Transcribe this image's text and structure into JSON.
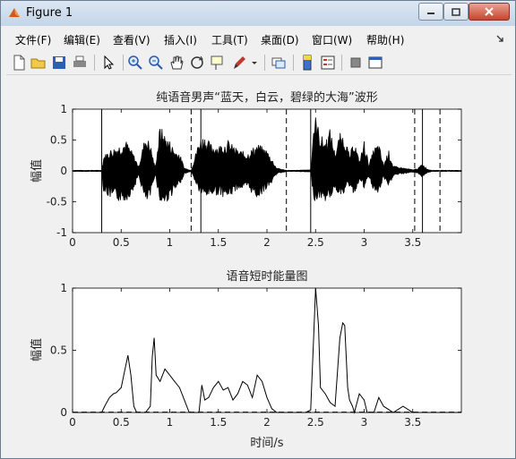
{
  "window": {
    "title": "Figure 1",
    "icons": [
      "matlab-icon",
      "minimize-icon",
      "maximize-icon",
      "close-icon"
    ]
  },
  "menu": [
    "文件(F)",
    "编辑(E)",
    "查看(V)",
    "插入(I)",
    "工具(T)",
    "桌面(D)",
    "窗口(W)",
    "帮助(H)"
  ],
  "toolbar": [
    "new-figure-icon",
    "open-icon",
    "save-icon",
    "print-icon",
    "pointer-icon",
    "zoom-in-icon",
    "zoom-out-icon",
    "pan-icon",
    "rotate-icon",
    "data-cursor-icon",
    "brush-icon",
    "link-icon",
    "colorbar-icon",
    "legend-icon",
    "hide-tools-icon",
    "show-tools-icon"
  ],
  "chart_data": [
    {
      "type": "line",
      "title": "纯语音男声“蓝天，白云，碧绿的大海”波形",
      "xlabel": "",
      "ylabel": "幅值",
      "xlim": [
        0,
        4
      ],
      "ylim": [
        -1,
        1
      ],
      "xticks": [
        "0",
        "0.5",
        "1",
        "1.5",
        "2",
        "2.5",
        "3",
        "3.5"
      ],
      "yticks": [
        "-1",
        "-0.5",
        "0",
        "0.5",
        "1"
      ],
      "envelope": {
        "x": [
          0.0,
          0.3,
          0.32,
          0.38,
          0.45,
          0.55,
          0.62,
          0.68,
          0.75,
          0.8,
          0.85,
          0.9,
          0.95,
          1.0,
          1.05,
          1.1,
          1.15,
          1.22,
          1.3,
          1.35,
          1.42,
          1.5,
          1.6,
          1.7,
          1.8,
          1.9,
          2.0,
          2.05,
          2.1,
          2.2,
          2.3,
          2.45,
          2.48,
          2.5,
          2.55,
          2.6,
          2.65,
          2.7,
          2.75,
          2.8,
          2.85,
          2.9,
          2.95,
          3.0,
          3.05,
          3.1,
          3.15,
          3.2,
          3.25,
          3.3,
          3.4,
          3.5,
          3.55,
          3.6,
          3.65,
          3.7,
          3.8,
          4.0
        ],
        "pos": [
          0.01,
          0.01,
          0.25,
          0.35,
          0.4,
          0.5,
          0.3,
          0.08,
          0.6,
          0.45,
          0.05,
          0.75,
          0.6,
          0.5,
          0.35,
          0.3,
          0.05,
          0.01,
          0.5,
          0.6,
          0.45,
          0.42,
          0.5,
          0.35,
          0.3,
          0.45,
          0.35,
          0.2,
          0.05,
          0.01,
          0.01,
          0.02,
          0.8,
          0.9,
          0.6,
          0.5,
          0.7,
          0.3,
          0.62,
          0.58,
          0.25,
          0.52,
          0.15,
          0.5,
          0.1,
          0.38,
          0.45,
          0.1,
          0.35,
          0.08,
          0.05,
          0.02,
          0.04,
          0.12,
          0.03,
          0.01,
          0.01,
          0.01
        ],
        "neg": [
          0.01,
          0.01,
          0.35,
          0.45,
          0.5,
          0.5,
          0.35,
          0.08,
          0.55,
          0.45,
          0.05,
          0.55,
          0.55,
          0.45,
          0.35,
          0.25,
          0.05,
          0.01,
          0.35,
          0.45,
          0.4,
          0.4,
          0.45,
          0.3,
          0.3,
          0.45,
          0.3,
          0.2,
          0.05,
          0.01,
          0.01,
          0.02,
          0.45,
          0.5,
          0.45,
          0.5,
          0.45,
          0.3,
          0.4,
          0.35,
          0.25,
          0.4,
          0.15,
          0.3,
          0.1,
          0.35,
          0.4,
          0.1,
          0.3,
          0.08,
          0.05,
          0.02,
          0.04,
          0.1,
          0.03,
          0.01,
          0.01,
          0.01
        ]
      },
      "solid_markers": [
        0.3,
        1.32,
        2.45,
        3.6
      ],
      "dashed_markers": [
        1.22,
        2.2,
        3.52,
        3.78
      ]
    },
    {
      "type": "line",
      "title": "语音短时能量图",
      "xlabel": "时间/s",
      "ylabel": "幅值",
      "xlim": [
        0,
        4
      ],
      "ylim": [
        0,
        1
      ],
      "xticks": [
        "0",
        "0.5",
        "1",
        "1.5",
        "2",
        "2.5",
        "3",
        "3.5"
      ],
      "yticks": [
        "0",
        "0.5",
        "1"
      ],
      "energy": {
        "x": [
          0.0,
          0.3,
          0.33,
          0.38,
          0.42,
          0.45,
          0.5,
          0.54,
          0.57,
          0.6,
          0.63,
          0.66,
          0.7,
          0.75,
          0.8,
          0.82,
          0.84,
          0.86,
          0.9,
          0.95,
          1.0,
          1.05,
          1.1,
          1.15,
          1.2,
          1.25,
          1.3,
          1.33,
          1.36,
          1.4,
          1.45,
          1.5,
          1.55,
          1.6,
          1.65,
          1.7,
          1.75,
          1.8,
          1.85,
          1.9,
          1.95,
          2.0,
          2.05,
          2.1,
          2.2,
          2.3,
          2.4,
          2.45,
          2.48,
          2.5,
          2.53,
          2.55,
          2.6,
          2.65,
          2.7,
          2.75,
          2.78,
          2.8,
          2.83,
          2.85,
          2.88,
          2.9,
          2.95,
          3.0,
          3.03,
          3.05,
          3.1,
          3.15,
          3.2,
          3.3,
          3.4,
          3.5,
          3.6,
          3.7,
          3.8,
          4.0
        ],
        "y": [
          0.0,
          0.0,
          0.05,
          0.12,
          0.15,
          0.16,
          0.2,
          0.35,
          0.46,
          0.3,
          0.05,
          0.0,
          0.0,
          0.0,
          0.05,
          0.45,
          0.6,
          0.3,
          0.25,
          0.35,
          0.3,
          0.25,
          0.2,
          0.1,
          0.0,
          0.0,
          0.0,
          0.22,
          0.1,
          0.12,
          0.2,
          0.25,
          0.18,
          0.2,
          0.1,
          0.15,
          0.25,
          0.22,
          0.12,
          0.3,
          0.25,
          0.12,
          0.03,
          0.0,
          0.0,
          0.0,
          0.0,
          0.02,
          0.6,
          1.0,
          0.7,
          0.2,
          0.15,
          0.08,
          0.05,
          0.6,
          0.72,
          0.7,
          0.2,
          0.1,
          0.05,
          0.0,
          0.15,
          0.1,
          0.0,
          0.0,
          0.0,
          0.12,
          0.05,
          0.0,
          0.05,
          0.0,
          0.0,
          0.0,
          0.0,
          0.0
        ]
      },
      "dashed_markers": [
        0.0,
        4.0
      ]
    }
  ]
}
